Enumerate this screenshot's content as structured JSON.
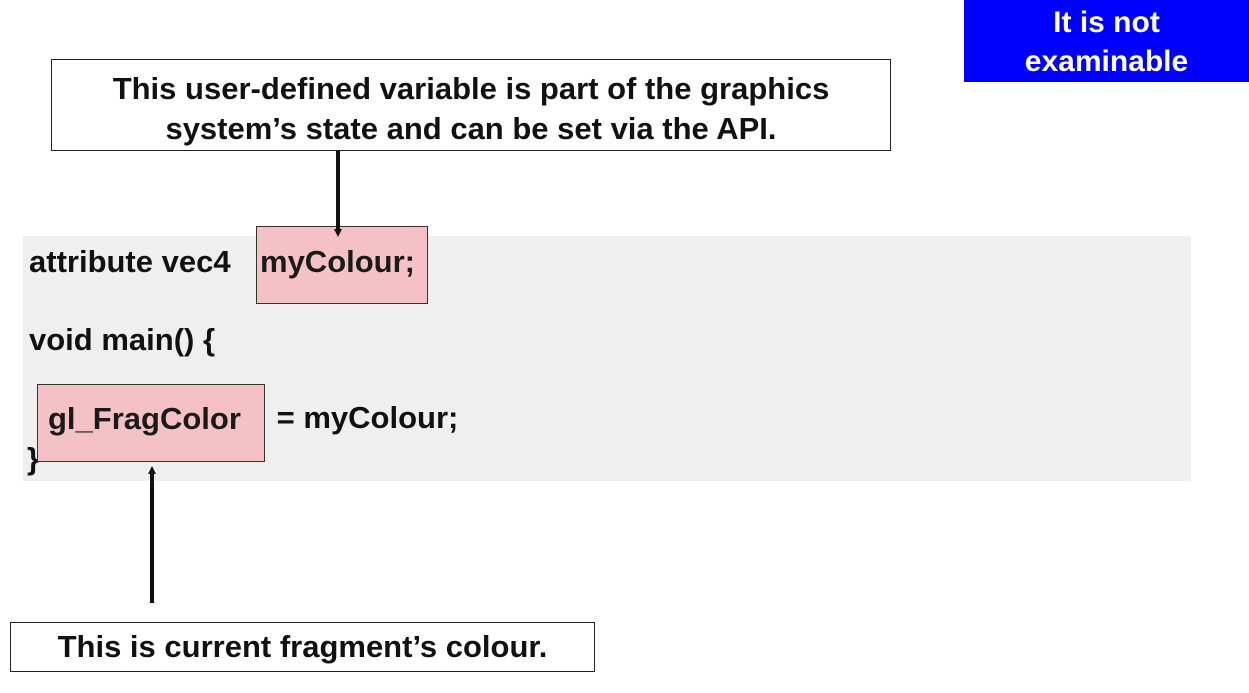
{
  "badge": {
    "line1": "It is not",
    "line2": "examinable",
    "color": "#0000ff"
  },
  "callout_top": {
    "line1": "This user-defined variable is part of the graphics",
    "line2": "system’s state and can be set via the API."
  },
  "code": {
    "line1_prefix": "attribute vec4 ",
    "line1_highlight": "myColour;",
    "line2": "void main() {",
    "line3_highlight": "gl_FragColor",
    "line3_suffix": " = myColour;",
    "line4": "}"
  },
  "callout_bottom": {
    "text": "This is current fragment’s colour."
  },
  "colors": {
    "highlight_fill": "#f4c1c6",
    "code_panel": "#efefef"
  }
}
